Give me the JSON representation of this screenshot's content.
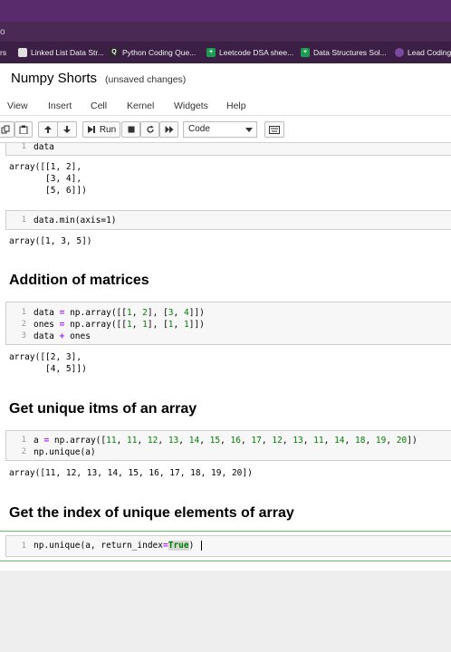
{
  "browser": {
    "url_fragment": "o",
    "bookmarks": [
      {
        "label": "rs",
        "icon": "",
        "color": ""
      },
      {
        "label": "Linked List Data Str...",
        "icon": "bookmark-icon",
        "color": "#e0e0e0"
      },
      {
        "label": "Python Coding Que...",
        "icon": "Q",
        "color": "#2b2b2b"
      },
      {
        "label": "Leetcode DSA shee...",
        "icon": "+",
        "color": "#1a9d50"
      },
      {
        "label": "Data Structures Sol...",
        "icon": "+",
        "color": "#1a9d50"
      },
      {
        "label": "Lead Coding",
        "icon": "avatar-icon",
        "color": "#7b4aa0"
      }
    ]
  },
  "notebook": {
    "title": "Numpy Shorts",
    "status": "(unsaved changes)"
  },
  "menu": [
    "View",
    "Insert",
    "Cell",
    "Kernel",
    "Widgets",
    "Help"
  ],
  "toolbar": {
    "run_label": "Run",
    "cell_type": "Code"
  },
  "cells": {
    "c1": {
      "lines": [
        "data"
      ],
      "output": "array([[1, 2],\n       [3, 4],\n       [5, 6]])"
    },
    "c2": {
      "lines": [
        "data.min(axis=1)"
      ],
      "output": "array([1, 3, 5])"
    },
    "h1": "Addition of matrices",
    "c3": {
      "output": "array([[2, 3],\n       [4, 5]])"
    },
    "h2": "Get unique itms of an array",
    "c4": {
      "output": "array([11, 12, 13, 14, 15, 16, 17, 18, 19, 20])"
    },
    "h3": "Get the index of unique elements of array"
  },
  "line_numbers": [
    "1",
    "2",
    "3"
  ]
}
